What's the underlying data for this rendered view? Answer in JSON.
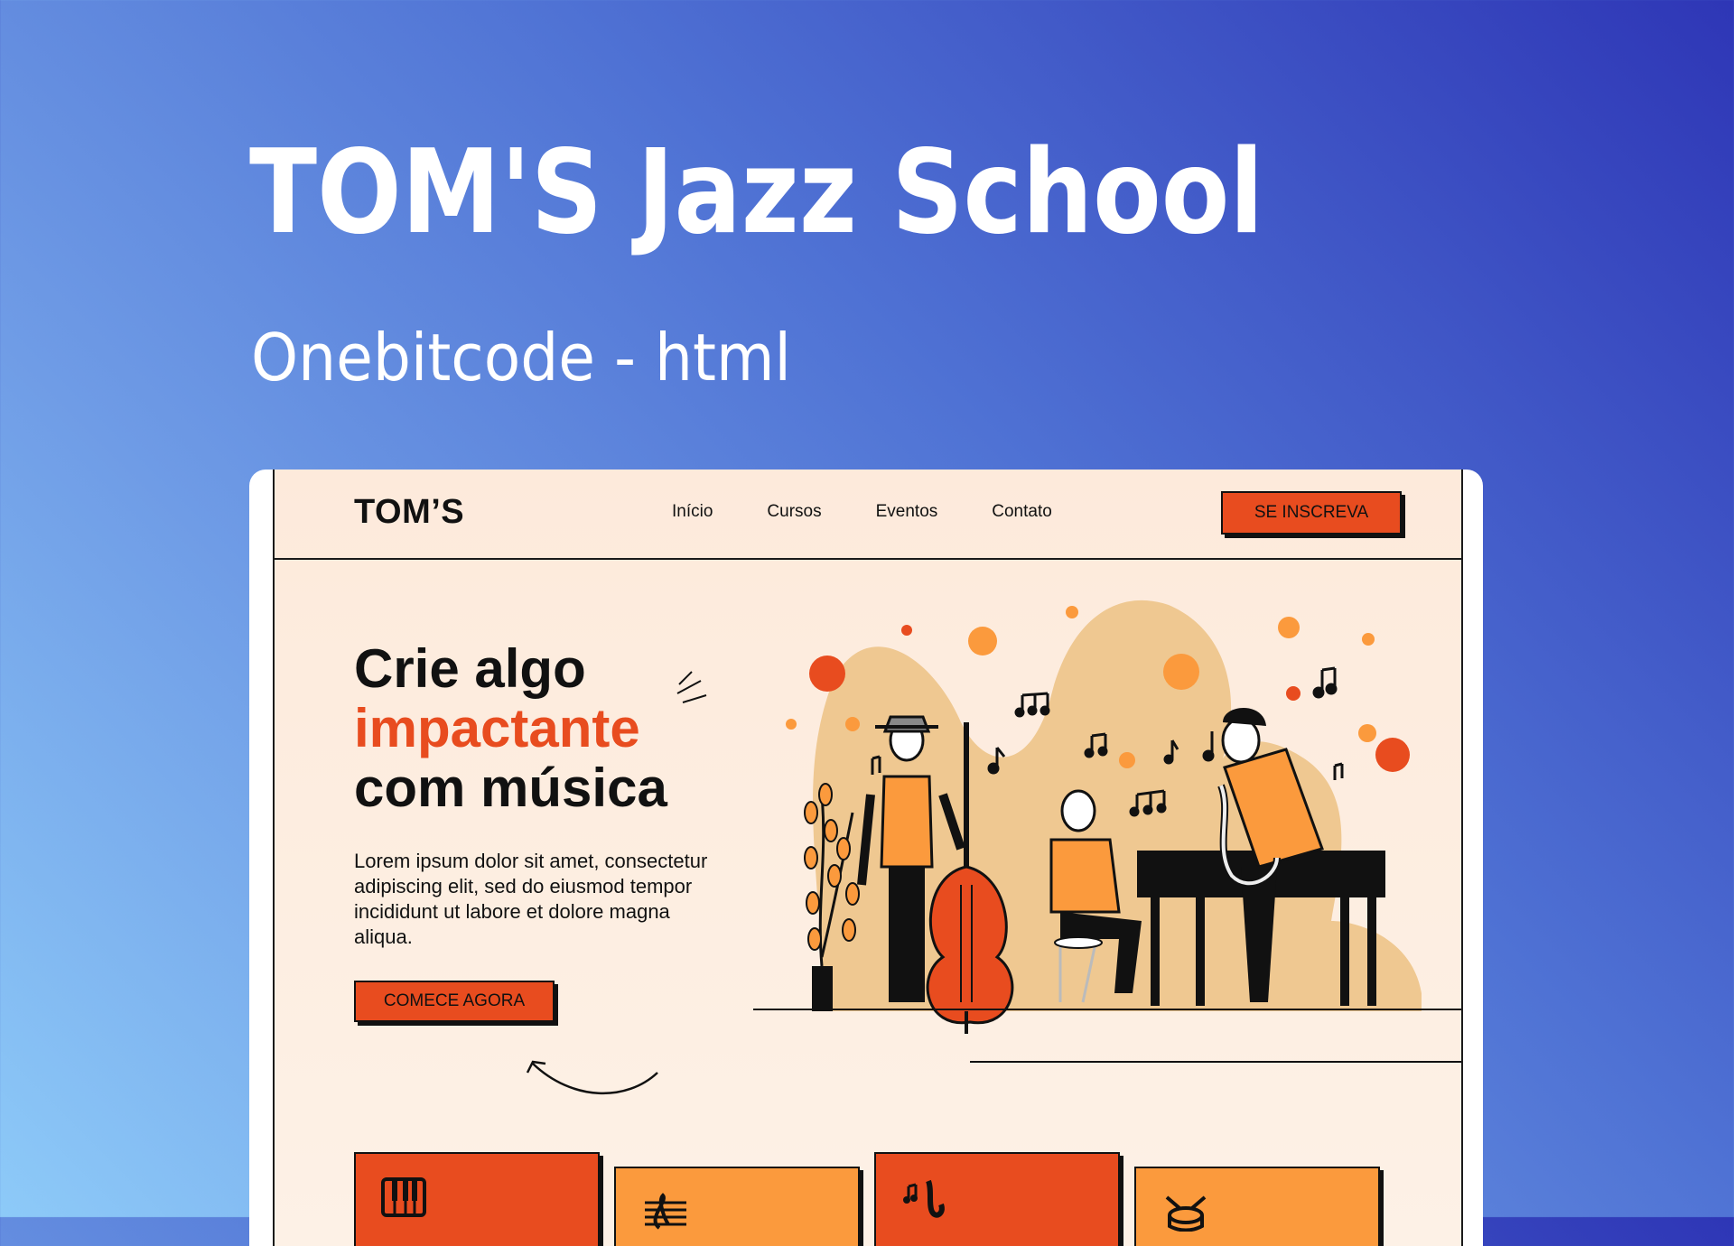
{
  "cover": {
    "title": "TOM'S Jazz School",
    "subtitle": "Onebitcode - html"
  },
  "site": {
    "logo": "TOM’S",
    "nav": [
      "Início",
      "Cursos",
      "Eventos",
      "Contato"
    ],
    "cta_top": "SE INSCREVA",
    "hero": {
      "line1": "Crie algo",
      "line2": "impactante",
      "line3": "com música",
      "text": "Lorem ipsum dolor sit amet, consectetur adipiscing elit, sed do eiusmod tempor incididunt ut labore et dolore magna aliqua.",
      "cta": "COMECE AGORA"
    },
    "cards": [
      {
        "icon": "piano-icon",
        "color": "#e84c1f"
      },
      {
        "icon": "music-staff-icon",
        "color": "#fb9a3d"
      },
      {
        "icon": "saxophone-icon",
        "color": "#e84c1f"
      },
      {
        "icon": "drums-icon",
        "color": "#fb9a3d"
      }
    ]
  },
  "colors": {
    "accent": "#e84c1f",
    "accent_light": "#fb9a3d",
    "page_bg": "#fdeadb",
    "text": "#111111"
  }
}
